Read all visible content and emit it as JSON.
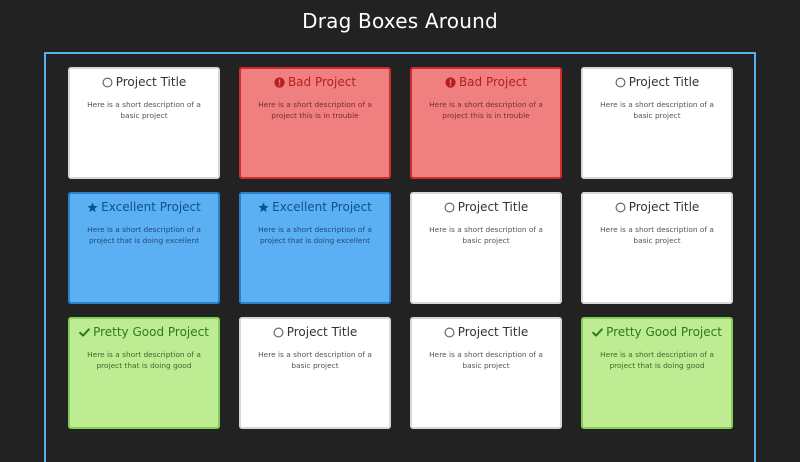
{
  "page": {
    "title": "Drag Boxes Around"
  },
  "cards": [
    {
      "variant": "basic",
      "icon": "circle-outline-icon",
      "title": "Project Title",
      "description": "Here is a short description of a basic project"
    },
    {
      "variant": "bad",
      "icon": "exclamation-circle-icon",
      "title": "Bad Project",
      "description": "Here is a short description of a project this is in trouble"
    },
    {
      "variant": "bad",
      "icon": "exclamation-circle-icon",
      "title": "Bad Project",
      "description": "Here is a short description of a project this is in trouble"
    },
    {
      "variant": "basic",
      "icon": "circle-outline-icon",
      "title": "Project Title",
      "description": "Here is a short description of a basic project"
    },
    {
      "variant": "excellent",
      "icon": "star-icon",
      "title": "Excellent Project",
      "description": "Here is a short description of a project that is doing excellent"
    },
    {
      "variant": "excellent",
      "icon": "star-icon",
      "title": "Excellent Project",
      "description": "Here is a short description of a project that is doing excellent"
    },
    {
      "variant": "basic",
      "icon": "circle-outline-icon",
      "title": "Project Title",
      "description": "Here is a short description of a basic project"
    },
    {
      "variant": "basic",
      "icon": "circle-outline-icon",
      "title": "Project Title",
      "description": "Here is a short description of a basic project"
    },
    {
      "variant": "good",
      "icon": "checkmark-icon",
      "title": "Pretty Good Project",
      "description": "Here is a short description of a project that is doing good"
    },
    {
      "variant": "basic",
      "icon": "circle-outline-icon",
      "title": "Project Title",
      "description": "Here is a short description of a basic project"
    },
    {
      "variant": "basic",
      "icon": "circle-outline-icon",
      "title": "Project Title",
      "description": "Here is a short description of a basic project"
    },
    {
      "variant": "good",
      "icon": "checkmark-icon",
      "title": "Pretty Good Project",
      "description": "Here is a short description of a project that is doing good"
    }
  ],
  "colors": {
    "background": "#222222",
    "board_border": "#5aafee",
    "bad": "#f08080",
    "excellent": "#5baff3",
    "good": "#bdec92",
    "basic": "#ffffff"
  }
}
